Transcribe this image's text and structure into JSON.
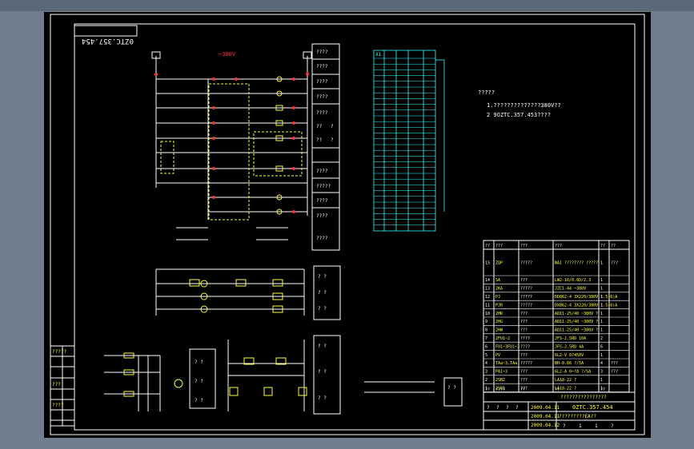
{
  "colors": {
    "sheet": "#000000",
    "frame": "#ffffff",
    "wire": "#ffffff",
    "component": "#ffff33",
    "terminal": "#ff3333",
    "label": "#33ff33",
    "bus": "#33ffff"
  },
  "title_block_rotated": "0ZTC.357.454",
  "voltage": "~380V",
  "notes": {
    "title": "?????",
    "line1": "1.??????????????380V??",
    "line2": "2 9OZTC.357.453????"
  },
  "legend_boxes": [
    "????",
    "????",
    "????",
    "????",
    "????",
    "??",
    "?",
    "??",
    "?",
    "????",
    "?????",
    "????",
    "????",
    "????"
  ],
  "terminal_strip": {
    "header": "X1"
  },
  "bom": {
    "header": [
      "??",
      "???",
      "???",
      "???",
      "??",
      "??"
    ],
    "rows": [
      {
        "no": "15",
        "code": "ZQP",
        "name": "?????",
        "model": "NAI ???????? ?????",
        "qty": "1",
        "note": "???"
      },
      {
        "no": "14",
        "code": "SA",
        "name": "???",
        "model": "LW2-16/0.6D/2.3",
        "qty": "1",
        "note": ""
      },
      {
        "no": "13",
        "code": "2KA",
        "name": "?????",
        "model": "JZC1-44 ~380V",
        "qty": "1",
        "note": ""
      },
      {
        "no": "12",
        "code": "PJ",
        "name": "?????",
        "model": "DD862-4 3X220/380V 1.5(6)A",
        "qty": "1",
        "note": ""
      },
      {
        "no": "11",
        "code": "PJR",
        "name": "?????",
        "model": "DX862-4 3X220/380V 1.5(6)A",
        "qty": "1",
        "note": ""
      },
      {
        "no": "10",
        "code": "2HR",
        "name": "???",
        "model": "AD11-25/40 ~380V ?",
        "qty": "1",
        "note": ""
      },
      {
        "no": "9",
        "code": "2HG",
        "name": "???",
        "model": "AD11-25/40 ~380V ?",
        "qty": "1",
        "note": ""
      },
      {
        "no": "8",
        "code": "2HW",
        "name": "???",
        "model": "AD11-25/40 ~380V ?",
        "qty": "1",
        "note": ""
      },
      {
        "no": "7",
        "code": "2FU1~2",
        "name": "????",
        "model": "JFS-2.5RD 10A",
        "qty": "2",
        "note": ""
      },
      {
        "no": "6",
        "code": "FU1~3FU1~3",
        "name": "????",
        "model": "JFS-2.5RD 4A",
        "qty": "6",
        "note": ""
      },
      {
        "no": "5",
        "code": "PV",
        "name": "???",
        "model": "6L2-V 0?450V",
        "qty": "1",
        "note": ""
      },
      {
        "no": "4",
        "code": "TAa~3,TAa",
        "name": "?????",
        "model": "BH-0.66 ?/5A",
        "qty": "4",
        "note": "???"
      },
      {
        "no": "3",
        "code": "PA1~3",
        "name": "???",
        "model": "6L2-A 0~?A ?/5A",
        "qty": "3",
        "note": "???"
      },
      {
        "no": "2",
        "code": "2SB2",
        "name": "???",
        "model": "LA18-22 ?",
        "qty": "1",
        "note": ""
      },
      {
        "no": "1",
        "code": "2SB1",
        "name": "???",
        "model": "LA18-22 ?",
        "qty": "1",
        "note": ""
      }
    ],
    "footer": [
      "??",
      "????",
      "??",
      "??",
      "??"
    ]
  },
  "title_block": {
    "name": "????????????????",
    "drawing_no": "0ZTC.357.454",
    "subtitle": "?????????EA??",
    "date1": "2009.04.11",
    "date2": "2009.04.11",
    "date3": "2009.04.12",
    "roles": [
      "?",
      "?",
      "?",
      "?"
    ],
    "scale": [
      "?",
      "1",
      "1",
      "?"
    ]
  },
  "left_margin": {
    "labels": [
      "?????",
      "???",
      "????"
    ]
  }
}
